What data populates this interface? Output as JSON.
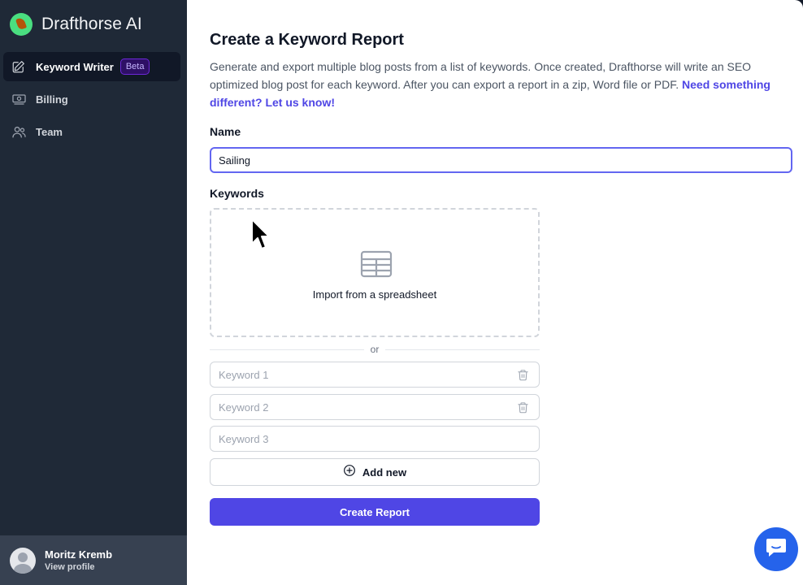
{
  "app": {
    "name": "Drafthorse AI"
  },
  "sidebar": {
    "items": [
      {
        "label": "Keyword Writer",
        "icon": "pencil-square-icon",
        "badge": "Beta",
        "active": true
      },
      {
        "label": "Billing",
        "icon": "banknotes-icon"
      },
      {
        "label": "Team",
        "icon": "users-icon"
      }
    ],
    "profile": {
      "name": "Moritz Kremb",
      "sub": "View profile"
    }
  },
  "main": {
    "title": "Create a Keyword Report",
    "description": "Generate and export multiple blog posts from a list of keywords. Once created, Drafthorse will write an SEO optimized blog post for each keyword. After you can export a report in a zip, Word file or PDF.",
    "description_link": "Need something different? Let us know!",
    "name_label": "Name",
    "name_value": "Sailing",
    "keywords_label": "Keywords",
    "import_text": "Import from a spreadsheet",
    "or_text": "or",
    "keywords": [
      {
        "placeholder": "Keyword 1",
        "deletable": true
      },
      {
        "placeholder": "Keyword 2",
        "deletable": true
      },
      {
        "placeholder": "Keyword 3",
        "deletable": false
      }
    ],
    "add_label": "Add new",
    "create_label": "Create Report"
  },
  "colors": {
    "accent": "#4f46e5",
    "sidebar": "#1f2937",
    "chat": "#2563eb"
  }
}
